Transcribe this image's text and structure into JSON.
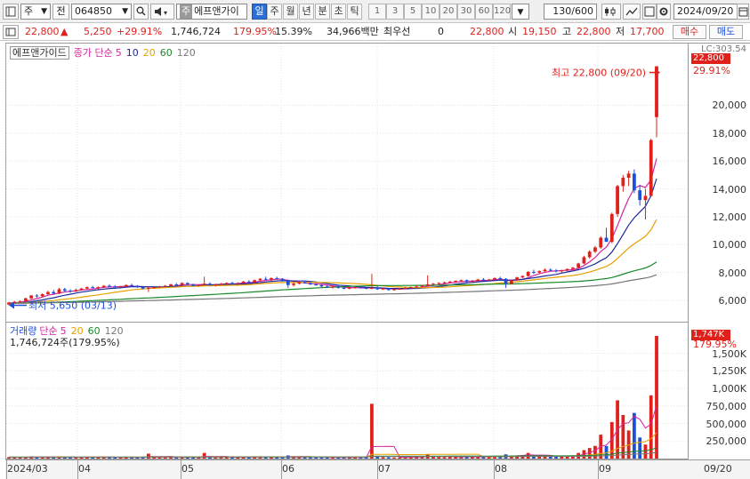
{
  "toolbar": {
    "market": "주",
    "market_type": "전",
    "code": "064850",
    "stock_type_badge": "주",
    "stock_name": "에프앤가이",
    "periods": [
      "일",
      "주",
      "월",
      "년",
      "분",
      "초",
      "틱"
    ],
    "active_period": "일",
    "intervals": [
      "1",
      "3",
      "5",
      "10",
      "20",
      "30",
      "60",
      "120"
    ],
    "view_count": "130/600",
    "date": "2024/09/20"
  },
  "info": {
    "price": "22,800",
    "change": "5,250",
    "change_pct": "+29.91%",
    "volume": "1,746,724",
    "volume_ratio": "179.95%",
    "turnover": "15.39%",
    "amount": "34,966백만",
    "best_ask_label": "최우선",
    "best_ask_qty": "0",
    "best_price": "22,800",
    "open_label": "시",
    "open": "19,150",
    "high_label": "고",
    "high": "22,800",
    "low_label": "저",
    "low": "17,700",
    "buy_label": "매수",
    "sell_label": "매도"
  },
  "price_pane": {
    "title": "에프앤가이드",
    "ma_label": "종가 단순",
    "ma_periods": [
      "5",
      "10",
      "20",
      "60",
      "120"
    ],
    "ma_colors": [
      "#d6249f",
      "#1a2a9a",
      "#e8a000",
      "#1a8a2a",
      "#777777"
    ],
    "high_annotation": "최고 22,800 (09/20)",
    "low_annotation": "최저 5,650 (03/13)",
    "y_ticks": [
      "20,000",
      "18,000",
      "16,000",
      "14,000",
      "12,000",
      "10,000",
      "8,000",
      "6,000"
    ],
    "last_price_badge": "22,800",
    "last_pct_badge": "29.91%",
    "top_label": "LC:303.54"
  },
  "volume_pane": {
    "title": "거래량",
    "ma_label": "단순",
    "ma_periods": [
      "5",
      "20",
      "60",
      "120"
    ],
    "ma_colors": [
      "#d6249f",
      "#e8a000",
      "#1a8a2a",
      "#777777"
    ],
    "current_volume": "1,746,724주(179.95%)",
    "badge_value": "1,747K",
    "badge_pct": "179.95%",
    "y_ticks": [
      "1,500K",
      "1,250K",
      "1,000K",
      "750,000",
      "500,000",
      "250,000"
    ]
  },
  "x_axis": {
    "labels": [
      "2024/03",
      "04",
      "05",
      "06",
      "07",
      "08",
      "09"
    ],
    "right_label": "09/20"
  },
  "chart_data": {
    "type": "candlestick",
    "ohlc": [
      [
        5700,
        5900,
        5650,
        5850
      ],
      [
        5850,
        5950,
        5800,
        5900
      ],
      [
        5900,
        6000,
        5850,
        5950
      ],
      [
        5950,
        6200,
        5900,
        6150
      ],
      [
        6150,
        6400,
        6100,
        6350
      ],
      [
        6350,
        6450,
        6200,
        6300
      ],
      [
        6300,
        6500,
        6250,
        6450
      ],
      [
        6450,
        6700,
        6400,
        6600
      ],
      [
        6600,
        6750,
        6450,
        6500
      ],
      [
        6500,
        6900,
        6450,
        6800
      ],
      [
        6800,
        6900,
        6600,
        6700
      ],
      [
        6700,
        6800,
        6550,
        6650
      ],
      [
        6650,
        6850,
        6600,
        6750
      ],
      [
        6750,
        6900,
        6700,
        6850
      ],
      [
        6850,
        7000,
        6800,
        6950
      ],
      [
        6950,
        7050,
        6850,
        6900
      ],
      [
        6900,
        7000,
        6800,
        6950
      ],
      [
        6950,
        7100,
        6900,
        7050
      ],
      [
        7050,
        7150,
        6950,
        7000
      ],
      [
        7000,
        7100,
        6900,
        6950
      ],
      [
        6950,
        7050,
        6850,
        7000
      ],
      [
        7000,
        7150,
        6950,
        7100
      ],
      [
        7100,
        7200,
        7000,
        7050
      ],
      [
        7050,
        7100,
        6900,
        6950
      ],
      [
        6950,
        7000,
        6800,
        6850
      ],
      [
        6850,
        6950,
        6600,
        6900
      ],
      [
        6900,
        7000,
        6850,
        6950
      ],
      [
        6950,
        7050,
        6900,
        7000
      ],
      [
        7000,
        7100,
        6950,
        7050
      ],
      [
        7050,
        7200,
        7000,
        7150
      ],
      [
        7150,
        7250,
        7050,
        7100
      ],
      [
        7100,
        7300,
        7050,
        7250
      ],
      [
        7250,
        7300,
        7100,
        7150
      ],
      [
        7150,
        7200,
        7000,
        7050
      ],
      [
        7050,
        7150,
        7000,
        7100
      ],
      [
        7100,
        7700,
        7050,
        7200
      ],
      [
        7200,
        7300,
        7050,
        7100
      ],
      [
        7100,
        7200,
        7000,
        7150
      ],
      [
        7150,
        7250,
        7100,
        7200
      ],
      [
        7200,
        7300,
        7150,
        7250
      ],
      [
        7250,
        7350,
        7150,
        7200
      ],
      [
        7200,
        7300,
        7100,
        7250
      ],
      [
        7250,
        7400,
        7200,
        7350
      ],
      [
        7350,
        7450,
        7250,
        7300
      ],
      [
        7300,
        7500,
        7250,
        7450
      ],
      [
        7450,
        7600,
        7400,
        7550
      ],
      [
        7550,
        7700,
        7450,
        7500
      ],
      [
        7500,
        7650,
        7400,
        7600
      ],
      [
        7600,
        7700,
        7500,
        7550
      ],
      [
        7550,
        7600,
        7350,
        7400
      ],
      [
        7400,
        7500,
        6900,
        7100
      ],
      [
        7100,
        7300,
        7000,
        7200
      ],
      [
        7200,
        7350,
        7150,
        7300
      ],
      [
        7300,
        7400,
        7200,
        7250
      ],
      [
        7250,
        7300,
        7100,
        7150
      ],
      [
        7150,
        7250,
        7050,
        7100
      ],
      [
        7100,
        7200,
        6950,
        7000
      ],
      [
        7000,
        7100,
        6900,
        6950
      ],
      [
        6950,
        7050,
        6850,
        7000
      ],
      [
        7000,
        7050,
        6850,
        6900
      ],
      [
        6900,
        6950,
        6800,
        6850
      ],
      [
        6850,
        6950,
        6800,
        6900
      ],
      [
        6900,
        7000,
        6850,
        6950
      ],
      [
        6950,
        7000,
        6850,
        6900
      ],
      [
        6900,
        6950,
        6800,
        6850
      ],
      [
        6850,
        7900,
        6800,
        6900
      ],
      [
        6900,
        7000,
        6750,
        6800
      ],
      [
        6800,
        6900,
        6750,
        6850
      ],
      [
        6850,
        6900,
        6700,
        6750
      ],
      [
        6750,
        6850,
        6700,
        6800
      ],
      [
        6800,
        6900,
        6750,
        6850
      ],
      [
        6850,
        6950,
        6800,
        6900
      ],
      [
        6900,
        7000,
        6850,
        6950
      ],
      [
        6950,
        7050,
        6900,
        7000
      ],
      [
        7000,
        7100,
        6950,
        7050
      ],
      [
        7050,
        7800,
        7000,
        7150
      ],
      [
        7150,
        7250,
        7100,
        7200
      ],
      [
        7200,
        7300,
        7150,
        7250
      ],
      [
        7250,
        7350,
        7200,
        7300
      ],
      [
        7300,
        7400,
        7250,
        7350
      ],
      [
        7350,
        7450,
        7300,
        7400
      ],
      [
        7400,
        7500,
        7350,
        7450
      ],
      [
        7450,
        7500,
        7300,
        7350
      ],
      [
        7350,
        7450,
        7300,
        7400
      ],
      [
        7400,
        7550,
        7350,
        7500
      ],
      [
        7500,
        7600,
        7400,
        7450
      ],
      [
        7450,
        7550,
        7400,
        7500
      ],
      [
        7500,
        7650,
        7450,
        7600
      ],
      [
        7600,
        7700,
        7500,
        7550
      ],
      [
        7550,
        7600,
        6900,
        7200
      ],
      [
        7200,
        7500,
        7150,
        7450
      ],
      [
        7450,
        7700,
        7400,
        7650
      ],
      [
        7650,
        7800,
        7600,
        7750
      ],
      [
        7750,
        8100,
        7700,
        8050
      ],
      [
        8050,
        8200,
        7900,
        8000
      ],
      [
        8000,
        8150,
        7950,
        8100
      ],
      [
        8100,
        8300,
        8000,
        8200
      ],
      [
        8200,
        8300,
        8100,
        8150
      ],
      [
        8150,
        8250,
        8000,
        8100
      ],
      [
        8100,
        8200,
        8000,
        8150
      ],
      [
        8150,
        8300,
        8100,
        8250
      ],
      [
        8250,
        8400,
        8100,
        8350
      ],
      [
        8350,
        8700,
        8300,
        8650
      ],
      [
        8650,
        9200,
        8600,
        9100
      ],
      [
        9100,
        9600,
        9000,
        9500
      ],
      [
        9500,
        9900,
        9400,
        9800
      ],
      [
        9800,
        10600,
        9700,
        10500
      ],
      [
        10500,
        11200,
        10300,
        10200
      ],
      [
        10200,
        12300,
        10100,
        12200
      ],
      [
        12200,
        14300,
        12000,
        14200
      ],
      [
        14200,
        15000,
        13800,
        14800
      ],
      [
        14800,
        15300,
        14200,
        15100
      ],
      [
        15100,
        15400,
        13700,
        13900
      ],
      [
        13900,
        14300,
        12800,
        13200
      ],
      [
        13200,
        14000,
        11800,
        13500
      ],
      [
        13500,
        17600,
        13400,
        17500
      ],
      [
        19150,
        22800,
        17700,
        22800
      ]
    ],
    "volume_k": [
      20,
      15,
      18,
      25,
      30,
      20,
      22,
      25,
      18,
      28,
      20,
      15,
      18,
      22,
      25,
      20,
      18,
      22,
      20,
      15,
      18,
      22,
      20,
      15,
      18,
      70,
      20,
      18,
      22,
      25,
      20,
      28,
      20,
      15,
      18,
      80,
      20,
      15,
      18,
      22,
      20,
      18,
      25,
      20,
      28,
      30,
      22,
      25,
      20,
      22,
      45,
      25,
      28,
      20,
      18,
      15,
      20,
      18,
      15,
      20,
      15,
      18,
      20,
      15,
      18,
      780,
      30,
      20,
      18,
      15,
      18,
      20,
      22,
      25,
      28,
      60,
      25,
      22,
      20,
      25,
      28,
      25,
      20,
      22,
      30,
      25,
      22,
      28,
      25,
      60,
      40,
      45,
      50,
      80,
      40,
      35,
      45,
      30,
      25,
      30,
      35,
      40,
      80,
      120,
      150,
      180,
      340,
      180,
      520,
      830,
      620,
      400,
      650,
      300,
      200,
      900,
      1747
    ],
    "ylim_price": [
      5000,
      22800
    ],
    "ylim_volume": [
      0,
      1747
    ],
    "high": {
      "value": 22800,
      "date": "09/20"
    },
    "low": {
      "value": 5650,
      "date": "03/13"
    }
  }
}
